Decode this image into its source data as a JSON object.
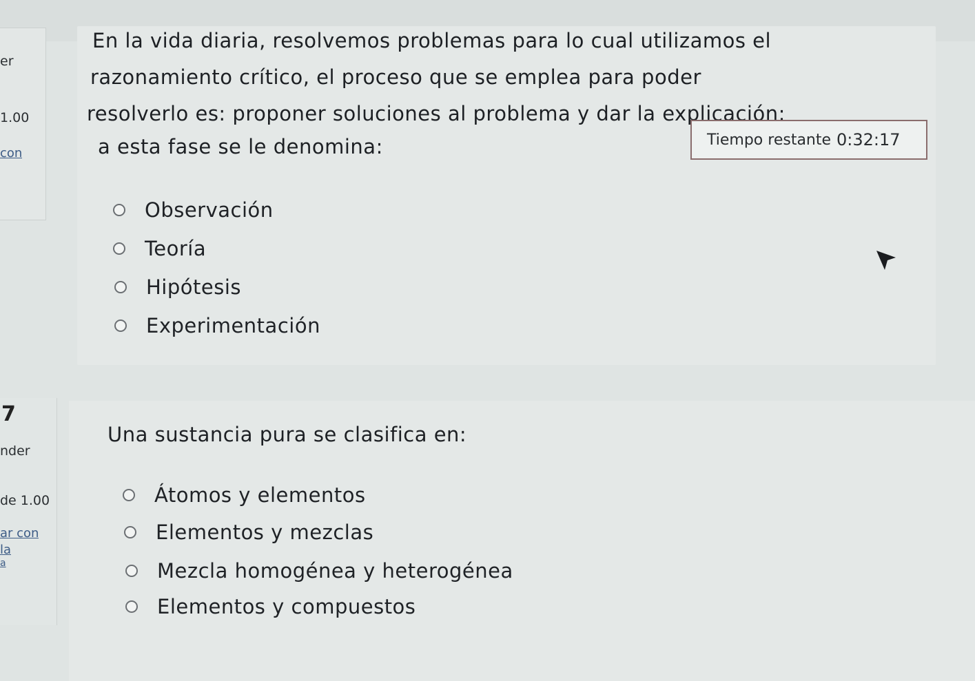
{
  "sidebar": {
    "q6_fragments": [
      "er",
      "1.00",
      "con"
    ],
    "q7_number": "7",
    "q7_fragments": [
      "nder",
      "de 1.00",
      "ar con",
      "la",
      "a"
    ]
  },
  "question6": {
    "lines": [
      "En la vida diaria, resolvemos problemas para lo cual utilizamos el",
      "razonamiento crítico, el proceso que se emplea para poder",
      "resolverlo es: proponer soluciones al problema y dar la explicación:",
      "a esta fase se le denomina:"
    ],
    "options": [
      "Observación",
      "Teoría",
      "Hipótesis",
      "Experimentación"
    ]
  },
  "timer": {
    "label": "Tiempo restante",
    "value": "0:32:17"
  },
  "question7": {
    "text": "Una sustancia pura se clasifica en:",
    "options": [
      "Átomos y elementos",
      "Elementos y mezclas",
      "Mezcla homogénea y heterogénea",
      "Elementos y compuestos"
    ]
  }
}
